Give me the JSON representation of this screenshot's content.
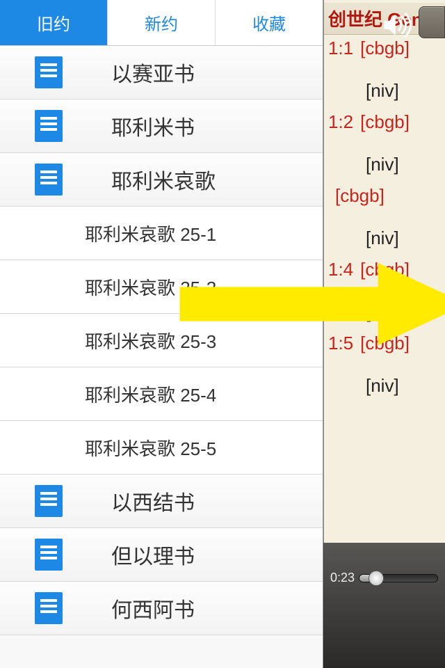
{
  "tabs": [
    {
      "label": "旧约",
      "active": true
    },
    {
      "label": "新约",
      "active": false
    },
    {
      "label": "收藏",
      "active": false
    }
  ],
  "books": [
    {
      "type": "book",
      "title": "以赛亚书"
    },
    {
      "type": "book",
      "title": "耶利米书"
    },
    {
      "type": "book",
      "title": "耶利米哀歌"
    },
    {
      "type": "chapter",
      "title": "耶利米哀歌 25-1"
    },
    {
      "type": "chapter",
      "title": "耶利米哀歌 25-2"
    },
    {
      "type": "chapter",
      "title": "耶利米哀歌 25-3"
    },
    {
      "type": "chapter",
      "title": "耶利米哀歌 25-4"
    },
    {
      "type": "chapter",
      "title": "耶利米哀歌 25-5"
    },
    {
      "type": "book",
      "title": "以西结书"
    },
    {
      "type": "book",
      "title": "但以理书"
    },
    {
      "type": "book",
      "title": "何西阿书"
    }
  ],
  "reader": {
    "header": "创世纪 Gen",
    "verses": [
      {
        "ref": "1:1",
        "cbgb": "[cbgb]",
        "niv": "[niv]"
      },
      {
        "ref": "1:2",
        "cbgb": "[cbgb]",
        "niv": "[niv]"
      },
      {
        "ref": "",
        "cbgb": "[cbgb]",
        "niv": "[niv]"
      },
      {
        "ref": "1:4",
        "cbgb": "[cbgb]",
        "niv": "[niv]"
      },
      {
        "ref": "1:5",
        "cbgb": "[cbgb]",
        "niv": "[niv]"
      }
    ]
  },
  "player": {
    "time": "0:23"
  }
}
